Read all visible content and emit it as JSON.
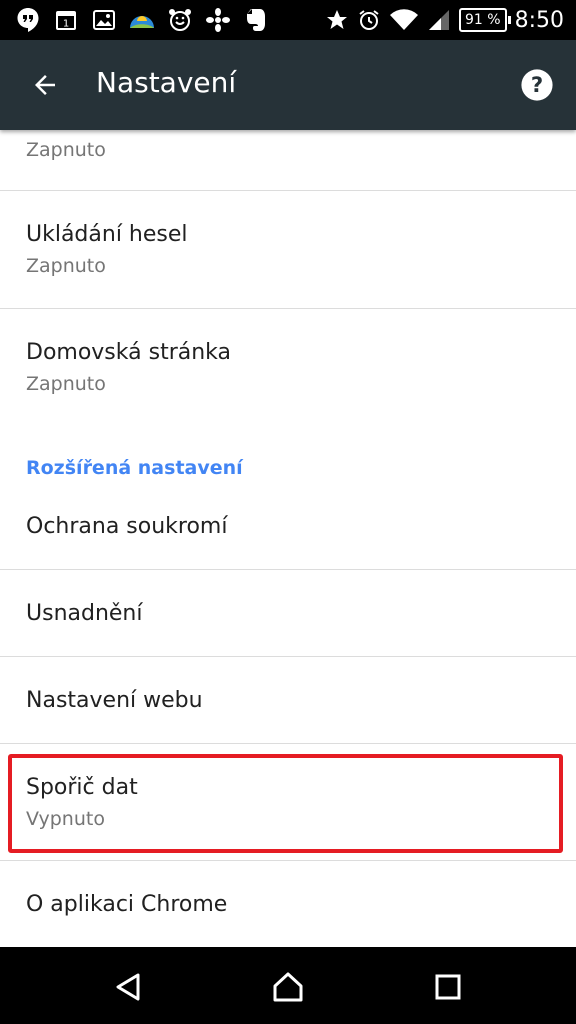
{
  "status_bar": {
    "battery_text": "91 %",
    "time": "8:50",
    "icons": [
      "hangouts-icon",
      "calendar-icon",
      "gallery-icon",
      "weather-icon",
      "alarm-app-icon",
      "flower-icon",
      "evernote-icon",
      "star-icon",
      "alarm-icon",
      "wifi-icon",
      "signal-icon",
      "battery-icon"
    ]
  },
  "app_bar": {
    "title": "Nastavení",
    "back_icon": "arrow-back-icon",
    "help_icon": "help-icon",
    "background": "#263238"
  },
  "settings": {
    "partial_item": {
      "subtitle": "Zapnuto"
    },
    "items": [
      {
        "title": "Ukládání hesel",
        "subtitle": "Zapnuto"
      },
      {
        "title": "Domovská stránka",
        "subtitle": "Zapnuto"
      }
    ],
    "section_header": "Rozšířená nastavení",
    "advanced_items": [
      {
        "title": "Ochrana soukromí"
      },
      {
        "title": "Usnadnění"
      },
      {
        "title": "Nastavení webu"
      },
      {
        "title": "Spořič dat",
        "subtitle": "Vypnuto",
        "highlighted": true
      },
      {
        "title": "O aplikaci Chrome"
      }
    ]
  },
  "colors": {
    "accent": "#4285f4",
    "highlight_border": "#e51c23"
  },
  "nav_bar": {
    "buttons": [
      "back-triangle-icon",
      "home-icon",
      "recents-icon"
    ]
  }
}
